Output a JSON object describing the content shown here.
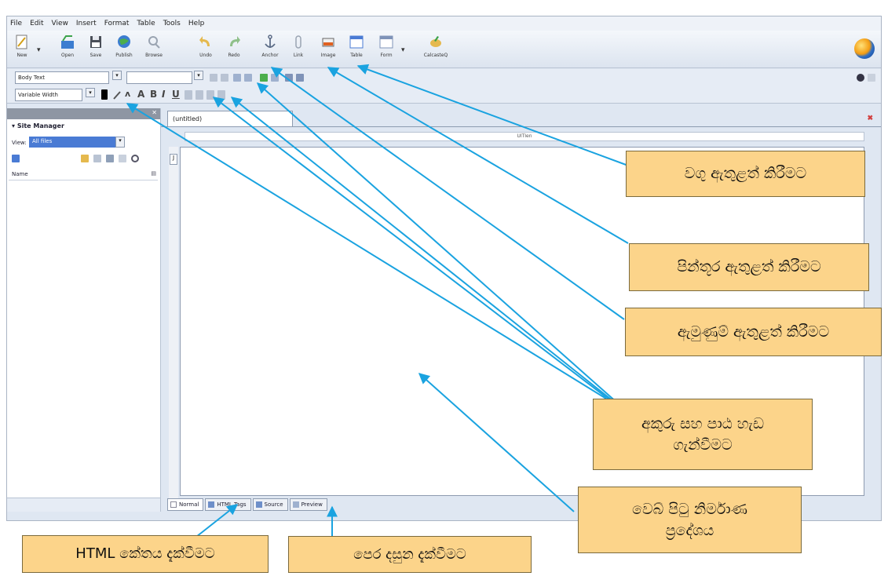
{
  "menu": [
    "File",
    "Edit",
    "View",
    "Insert",
    "Format",
    "Table",
    "Tools",
    "Help"
  ],
  "toolbar_main": [
    {
      "label": "New",
      "icon": "new-page-icon"
    },
    {
      "label": "Open",
      "icon": "open-icon"
    },
    {
      "label": "Save",
      "icon": "save-icon"
    },
    {
      "label": "Publish",
      "icon": "publish-icon"
    },
    {
      "label": "Browse",
      "icon": "browse-icon"
    },
    {
      "label": "Undo",
      "icon": "undo-icon"
    },
    {
      "label": "Redo",
      "icon": "redo-icon"
    },
    {
      "label": "Anchor",
      "icon": "anchor-icon"
    },
    {
      "label": "Link",
      "icon": "link-icon"
    },
    {
      "label": "Image",
      "icon": "image-icon"
    },
    {
      "label": "Table",
      "icon": "table-icon"
    },
    {
      "label": "Form",
      "icon": "form-icon"
    },
    {
      "label": "CalcasteQ",
      "icon": "cascade-icon"
    }
  ],
  "format": {
    "paragraph_style": "Body Text",
    "font_family": "Variable Width",
    "bold": "B",
    "italic": "I",
    "underline": "U"
  },
  "sidebar": {
    "title": "Site Manager",
    "view_label": "View:",
    "view_value": "All files",
    "name_column": "Name"
  },
  "editor": {
    "doc_tab": "(untitled)",
    "ruler_text": "UITIen",
    "gutter_mark": "J"
  },
  "view_tabs": [
    "Normal",
    "HTML Tags",
    "Source",
    "Preview"
  ],
  "callouts": {
    "table": "වගු ඇතුළත් කිරීමට",
    "image": "පින්තූර ඇතුළත් කිරීමට",
    "anchor": "ඇමුණුම් ඇතුළත් කිරීමට",
    "text_format_line1": "අකුරු සහ පාඨ හැඩ",
    "text_format_line2": "ගැන්වීමට",
    "page_area_line1": "වෙබ් පිටු නිර්මාණ",
    "page_area_line2": "ප්‍රදේශය",
    "html_tags": "HTML කේතය දැක්වීමට",
    "preview": "පෙර දසුන දැක්වීමට"
  },
  "colors": {
    "callout_bg": "#fcd48a",
    "arrow": "#1aa3e0",
    "selection": "#4a7bd4"
  }
}
